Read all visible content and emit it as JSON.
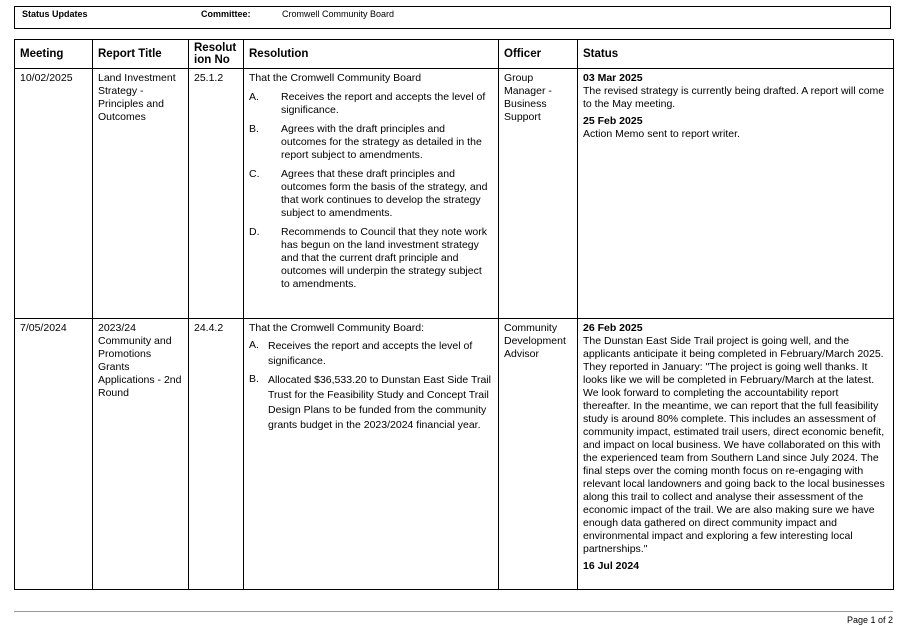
{
  "header": {
    "status_updates": "Status Updates",
    "committee_label": "Committee:",
    "committee_value": "Cromwell Community Board"
  },
  "columns": [
    "Meeting",
    "Report Title",
    "Resolut ion No",
    "Resolution",
    "Officer",
    "Status"
  ],
  "rows": [
    {
      "meeting": "10/02/2025",
      "report_title": "Land Investment Strategy - Principles and Outcomes",
      "resolution_no": "25.1.2",
      "resolution_intro": "That the Cromwell Community Board",
      "resolution_items": [
        {
          "label": "A.",
          "text": "Receives the report and accepts the level of significance."
        },
        {
          "label": "B.",
          "text": "Agrees with the draft principles and outcomes for the strategy as detailed in the report subject to amendments."
        },
        {
          "label": "C.",
          "text": "Agrees that these draft principles and outcomes form the basis of the strategy, and that work continues to develop the strategy subject to amendments."
        },
        {
          "label": "D.",
          "text": "Recommends to Council that they note work has begun on the land investment strategy and that the current draft principle and outcomes will underpin the strategy subject to amendments."
        }
      ],
      "officer": "Group Manager - Business Support",
      "status": [
        {
          "date": "03 Mar 2025",
          "text": "The revised strategy is currently being drafted. A report will come to the May meeting."
        },
        {
          "date": "25 Feb 2025",
          "text": "Action Memo sent to report writer."
        }
      ]
    },
    {
      "meeting": "7/05/2024",
      "report_title": "2023/24 Community and Promotions Grants Applications - 2nd Round",
      "resolution_no": "24.4.2",
      "resolution_intro": "That the Cromwell Community Board:",
      "resolution_items": [
        {
          "label": "A.",
          "text": "Receives the report and accepts the level of significance."
        },
        {
          "label": "B.",
          "text": "Allocated $36,533.20 to Dunstan East Side Trail Trust for the Feasibility Study and Concept Trail Design Plans to be funded from the community grants budget in the 2023/2024 financial year."
        }
      ],
      "officer": "Community Development Advisor",
      "status": [
        {
          "date": "26 Feb 2025",
          "text": "The Dunstan East Side Trail project is going well, and the applicants anticipate it being completed in February/March 2025. They reported in January: \"The project is going well thanks. It looks like we will be completed in February/March at the latest. We look forward to completing the accountability report thereafter. In the meantime, we can report that the full feasibility study is around 80% complete. This includes an assessment of community impact, estimated trail users, direct economic benefit, and impact on local business. We have collaborated on this with the experienced team from Southern Land since July 2024. The final steps over the coming month focus on re-engaging with relevant local landowners and going back to the local businesses along this trail to collect and analyse their assessment of the economic impact of the trail. We are also making sure we have enough data gathered on direct community impact and environmental impact and exploring a few interesting local partnerships.\""
        },
        {
          "date": "16 Jul 2024",
          "text": ""
        }
      ]
    }
  ],
  "footer": {
    "page": "Page 1 of 2"
  }
}
